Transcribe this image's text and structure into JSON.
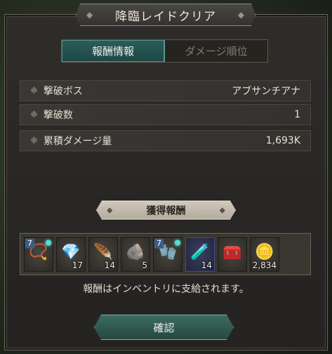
{
  "window": {
    "title": "降臨レイドクリア"
  },
  "tabs": [
    {
      "label": "報酬情報",
      "active": true
    },
    {
      "label": "ダメージ順位",
      "active": false
    }
  ],
  "info": [
    {
      "label": "撃破ボス",
      "value": "アブサンチアナ"
    },
    {
      "label": "撃破数",
      "value": "1"
    },
    {
      "label": "累積ダメージ量",
      "value": "1,693K"
    }
  ],
  "rewards_header": "獲得報酬",
  "rewards": [
    {
      "icon": "amulet-icon",
      "glyph": "📿",
      "badge": "7",
      "dot": true,
      "qty": "",
      "rarity": "normal"
    },
    {
      "icon": "red-crystal-icon",
      "glyph": "💎",
      "badge": "",
      "dot": false,
      "qty": "17",
      "rarity": "normal"
    },
    {
      "icon": "scale-material-icon",
      "glyph": "🪶",
      "badge": "",
      "dot": false,
      "qty": "14",
      "rarity": "normal"
    },
    {
      "icon": "metal-ore-icon",
      "glyph": "🪨",
      "badge": "",
      "dot": false,
      "qty": "5",
      "rarity": "normal"
    },
    {
      "icon": "gauntlet-icon",
      "glyph": "🧤",
      "badge": "7",
      "dot": true,
      "qty": "",
      "rarity": "normal"
    },
    {
      "icon": "red-potion-icon",
      "glyph": "🧪",
      "badge": "",
      "dot": false,
      "qty": "14",
      "rarity": "epic"
    },
    {
      "icon": "treasure-chest-icon",
      "glyph": "🧰",
      "badge": "",
      "dot": false,
      "qty": "",
      "rarity": "normal"
    },
    {
      "icon": "gold-coin-icon",
      "glyph": "🪙",
      "badge": "",
      "dot": false,
      "qty": "2,834",
      "rarity": "normal"
    }
  ],
  "notice": "報酬はインベントリに支給されます。",
  "confirm_label": "確認",
  "colors": {
    "tab_active": "#2b5d5a",
    "confirm": "#3c6b63",
    "epic_slot": "#3b3f63"
  }
}
